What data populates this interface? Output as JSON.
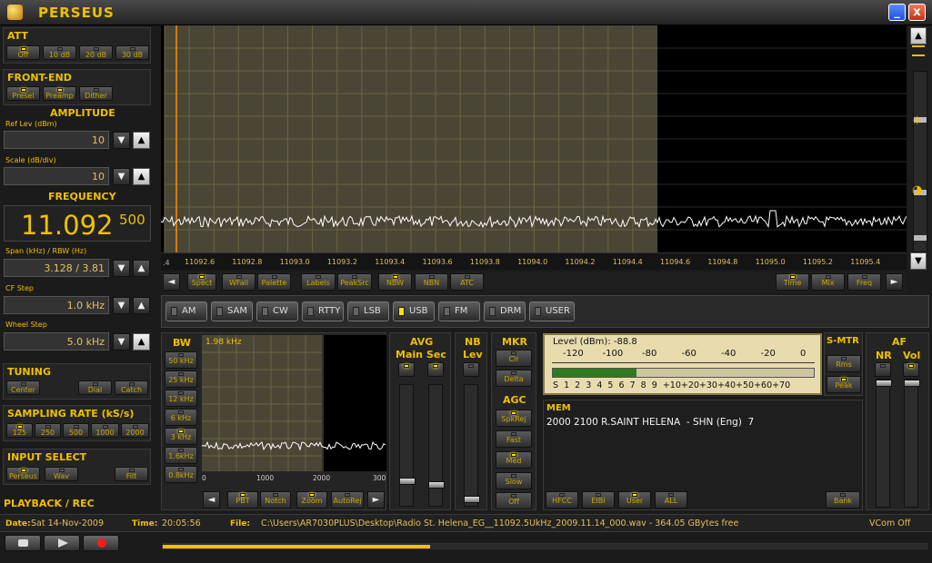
{
  "app": {
    "title": "PERSEUS",
    "minimize": "_",
    "close": "x"
  },
  "att": {
    "title": "ATT",
    "buttons": [
      "Off",
      "10 dB",
      "20 dB",
      "30 dB"
    ]
  },
  "frontend": {
    "title": "FRONT-END",
    "buttons": [
      "Presel",
      "Preamp",
      "Dither"
    ]
  },
  "amplitude": {
    "title": "AMPLITUDE",
    "ref_label": "Ref Lev (dBm)",
    "ref_value": "10",
    "scale_label": "Scale (dB/div)",
    "scale_value": "10"
  },
  "frequency": {
    "title": "FREQUENCY",
    "main": "11.092",
    "sub": "500",
    "span_label": "Span (kHz) / RBW (Hz)",
    "span_value": "3.128 / 3.81",
    "cf_label": "CF Step",
    "cf_value": "1.0 kHz",
    "wheel_label": "Wheel Step",
    "wheel_value": "5.0 kHz"
  },
  "tuning": {
    "title": "TUNING",
    "buttons": [
      "Center",
      "Dial",
      "Catch"
    ]
  },
  "sampling": {
    "title": "SAMPLING RATE (kS/s)",
    "buttons": [
      "125",
      "250",
      "500",
      "1000",
      "2000"
    ]
  },
  "input": {
    "title": "INPUT SELECT",
    "buttons": [
      "Perseus",
      "Wav",
      "Filt"
    ]
  },
  "playback": {
    "title": "PLAYBACK / REC"
  },
  "spectrum": {
    "scale_left": ".4",
    "ticks": [
      "11092.6",
      "11092.8",
      "11093.0",
      "11093.2",
      "11093.4",
      "11093.6",
      "11093.8",
      "11094.0",
      "11094.2",
      "11094.4",
      "11094.6",
      "11094.8",
      "11095.0",
      "11095.2",
      "11095.4"
    ]
  },
  "toolbar": {
    "left": [
      "Spect",
      "WFall",
      "Palette",
      "Labels",
      "PeakSrc",
      "NBW",
      "NBN",
      "ATC"
    ],
    "right": [
      "Time",
      "Mix",
      "Freq"
    ],
    "back": "◄",
    "fwd": "►"
  },
  "modes": [
    "AM",
    "SAM",
    "CW",
    "RTTY",
    "LSB",
    "USB",
    "FM",
    "DRM",
    "USER"
  ],
  "bw": {
    "title": "BW",
    "buttons": [
      "50 kHz",
      "25 kHz",
      "12 kHz",
      "6 kHz",
      "3 kHz",
      "1.6kHz",
      "0.8kHz"
    ],
    "value": "1.98 kHz",
    "ticks": [
      "0",
      "1000",
      "2000",
      "300"
    ],
    "bottom": [
      "PBT",
      "Notch",
      "Zoom",
      "AutoRej"
    ]
  },
  "avg": {
    "title": "AVG",
    "main": "Main",
    "sec": "Sec"
  },
  "nb": {
    "title": "NB",
    "lev": "Lev"
  },
  "mkr": {
    "title": "MKR",
    "buttons": [
      "Clr",
      "Delta"
    ]
  },
  "agc": {
    "title": "AGC",
    "buttons": [
      "SpkRej",
      "Fast",
      "Med",
      "Slow",
      "Off"
    ]
  },
  "smeter": {
    "level_label": "Level (dBm): -88.8",
    "dbm_ticks": [
      "-120",
      "-100",
      "-80",
      "-60",
      "-40",
      "-20",
      "0"
    ],
    "s_scale": "S  1  2  3  4  5  6  7  8  9  +10+20+30+40+50+60+70",
    "level_fraction": 0.32,
    "title": "S-MTR",
    "buttons": [
      "Rms",
      "Peak"
    ]
  },
  "mem": {
    "title": "MEM",
    "entry": "2000 2100 R.SAINT HELENA  - SHN (Eng)  7",
    "buttons": [
      "HFCC",
      "EIBI",
      "User",
      "ALL"
    ],
    "bank": "Bank"
  },
  "af": {
    "title": "AF",
    "nr": "NR",
    "vol": "Vol"
  },
  "status": {
    "date_label": "Date:",
    "date": "Sat 14-Nov-2009",
    "time_label": "Time:",
    "time": "20:05:56",
    "file_label": "File:",
    "file": "C:\\Users\\AR7030PLUS\\Desktop\\Radio St. Helena_EG__11092.5UkHz_2009.11.14_000.wav - 364.05 GBytes free",
    "vcom": "VCom Off"
  },
  "playback_progress": 0.35,
  "colors": {
    "accent": "#f0c000",
    "led_on": "#ffe000",
    "spectrum_band": "#4a4636",
    "trace": "#ffffff",
    "cursor": "#ff8c00"
  }
}
